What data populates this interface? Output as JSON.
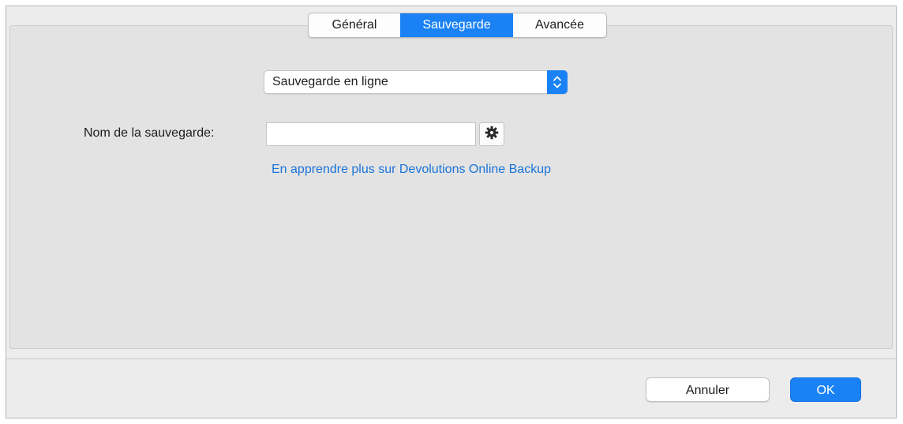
{
  "tabs": [
    {
      "label": "Général",
      "active": false
    },
    {
      "label": "Sauvegarde",
      "active": true
    },
    {
      "label": "Avancée",
      "active": false
    }
  ],
  "backup_type": {
    "selected": "Sauvegarde en ligne"
  },
  "backup_name": {
    "label": "Nom de la sauvegarde:",
    "value": ""
  },
  "learn_more_link": "En apprendre plus sur Devolutions Online Backup",
  "buttons": {
    "cancel": "Annuler",
    "ok": "OK"
  },
  "colors": {
    "accent": "#1a82f5",
    "link": "#1a74d9",
    "panel_background": "#e3e3e3",
    "window_background": "#ececec"
  },
  "icons": {
    "select_arrows": "chevron-up-down-icon",
    "settings": "gear-icon"
  }
}
